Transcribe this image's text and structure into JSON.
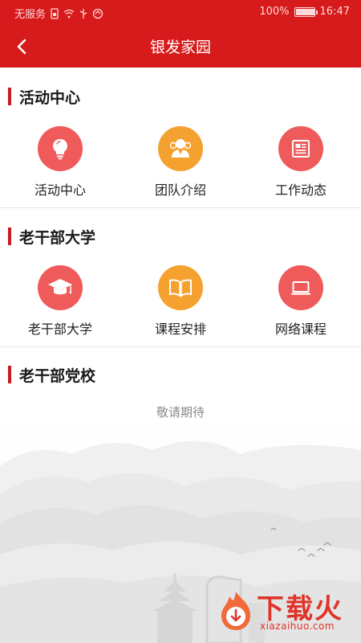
{
  "status_bar": {
    "carrier": "无服务",
    "battery_percent": "100%",
    "battery_level": 1.0,
    "time": "16:47"
  },
  "nav": {
    "title": "银发家园",
    "back_icon": "chevron-left-icon"
  },
  "sections": [
    {
      "title": "活动中心",
      "items": [
        {
          "label": "活动中心",
          "icon": "lightbulb-icon",
          "color": "#ef5a5a"
        },
        {
          "label": "团队介绍",
          "icon": "team-icon",
          "color": "#f5a12f"
        },
        {
          "label": "工作动态",
          "icon": "news-icon",
          "color": "#ef5a5a"
        }
      ]
    },
    {
      "title": "老干部大学",
      "items": [
        {
          "label": "老干部大学",
          "icon": "graduation-cap-icon",
          "color": "#ef5a5a"
        },
        {
          "label": "课程安排",
          "icon": "book-icon",
          "color": "#f5a12f"
        },
        {
          "label": "网络课程",
          "icon": "laptop-icon",
          "color": "#ef5a5a"
        }
      ]
    },
    {
      "title": "老干部党校",
      "placeholder": "敬请期待"
    }
  ],
  "watermark": {
    "brand": "下载火",
    "domain": "xiazaihuo.com"
  },
  "colors": {
    "header": "#d71a1b",
    "accent_bar": "#c81a1f",
    "red_icon": "#ef5a5a",
    "orange_icon": "#f5a12f"
  }
}
